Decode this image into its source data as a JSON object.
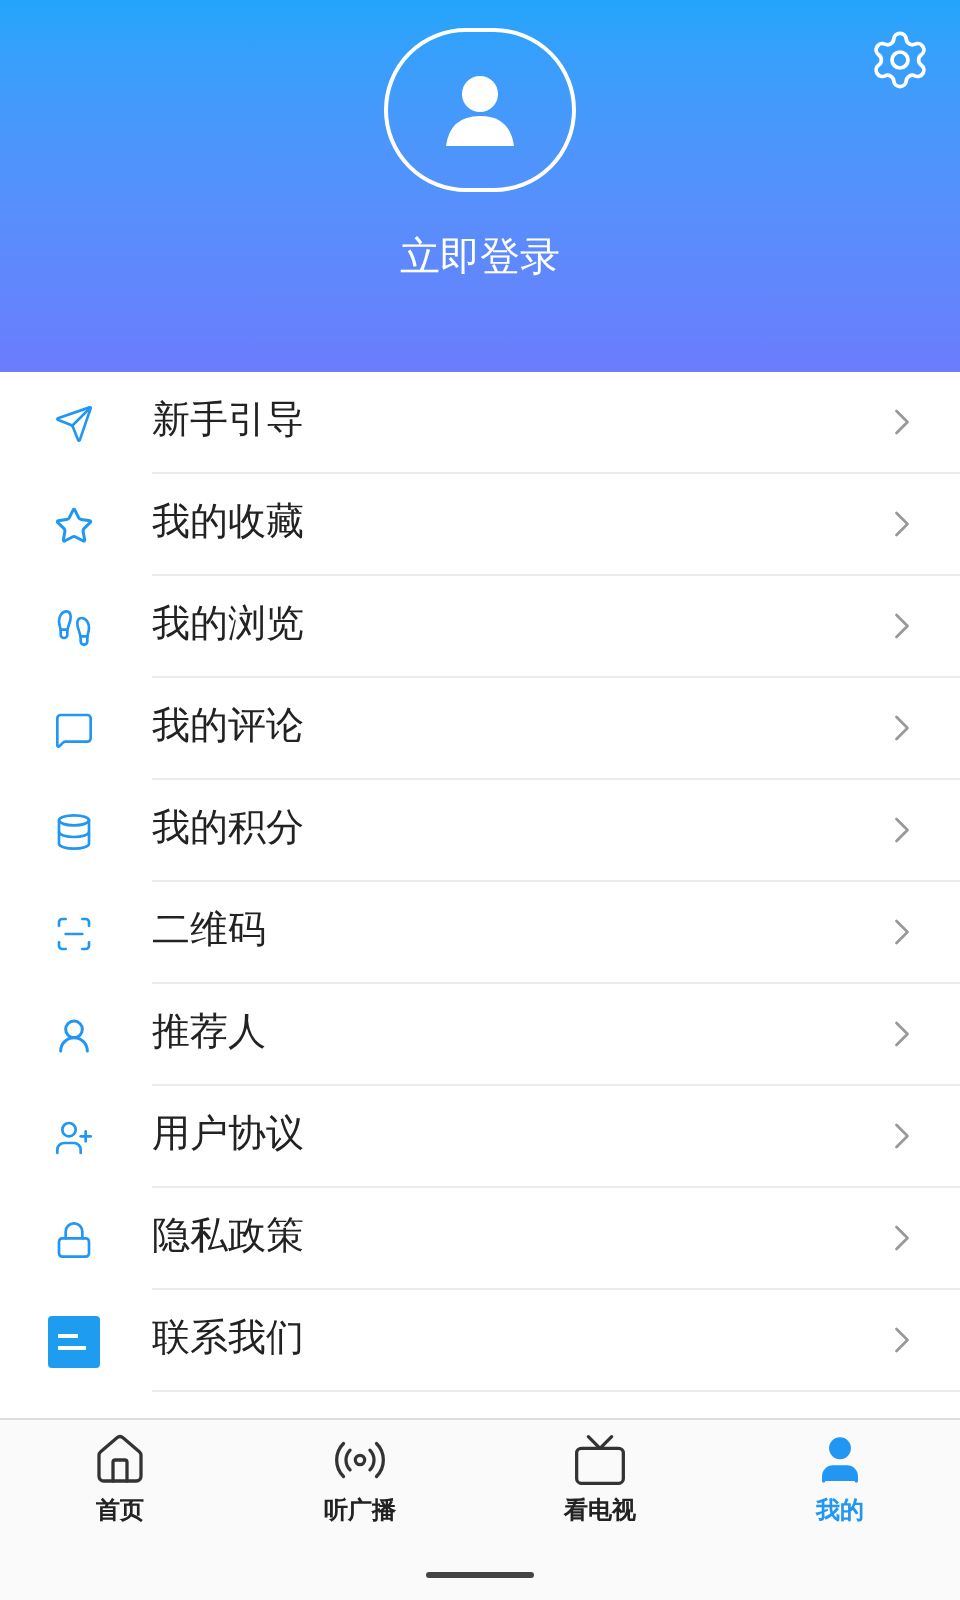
{
  "header": {
    "login": "立即登录"
  },
  "menu": [
    {
      "kind": "guide",
      "label": "新手引导"
    },
    {
      "kind": "favorites",
      "label": "我的收藏"
    },
    {
      "kind": "history",
      "label": "我的浏览"
    },
    {
      "kind": "comments",
      "label": "我的评论"
    },
    {
      "kind": "points",
      "label": "我的积分"
    },
    {
      "kind": "qrcode",
      "label": "二维码"
    },
    {
      "kind": "referrer",
      "label": "推荐人"
    },
    {
      "kind": "agreement",
      "label": "用户协议"
    },
    {
      "kind": "privacy",
      "label": "隐私政策"
    },
    {
      "kind": "contact",
      "label": "联系我们"
    }
  ],
  "tabs": [
    {
      "kind": "home",
      "label": "首页",
      "selected": false
    },
    {
      "kind": "radio",
      "label": "听广播",
      "selected": false
    },
    {
      "kind": "tv",
      "label": "看电视",
      "selected": false
    },
    {
      "kind": "me",
      "label": "我的",
      "selected": true
    }
  ]
}
